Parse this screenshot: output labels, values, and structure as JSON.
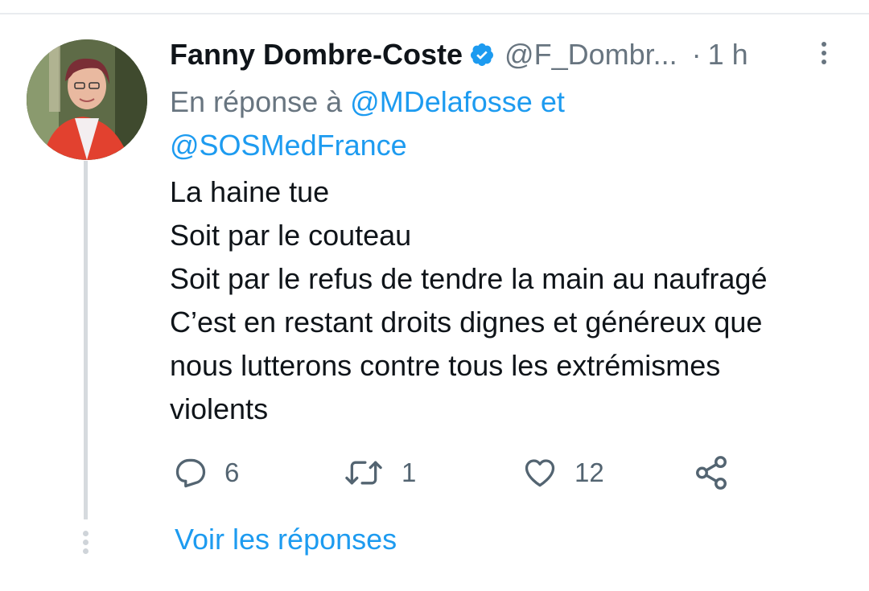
{
  "tweet": {
    "author_name": "Fanny Dombre-Coste",
    "handle": "@F_Dombr...",
    "separator": "·",
    "time": "1 h",
    "reply_prefix": "En réponse à",
    "reply_mention_1": "@MDelafosse",
    "reply_joiner": "et",
    "reply_mention_2": "@SOSMedFrance",
    "body_lines": [
      "La haine tue",
      "Soit par le couteau",
      "Soit par le refus de tendre la main au naufragé",
      "C’est en restant droits dignes et généreux que",
      "nous lutterons contre tous les extrémismes",
      "violents"
    ]
  },
  "actions": {
    "reply_count": "6",
    "retweet_count": "1",
    "like_count": "12"
  },
  "footer": {
    "view_replies": "Voir les réponses"
  },
  "icons": {
    "verified": "verified-badge-icon",
    "more": "more-vertical-icon",
    "reply": "reply-icon",
    "retweet": "retweet-icon",
    "like": "heart-icon",
    "share": "share-icon"
  },
  "colors": {
    "accent": "#1d9bf0",
    "secondary_text": "#687580",
    "primary_text": "#0f1419",
    "thread_line": "#d6dade"
  }
}
